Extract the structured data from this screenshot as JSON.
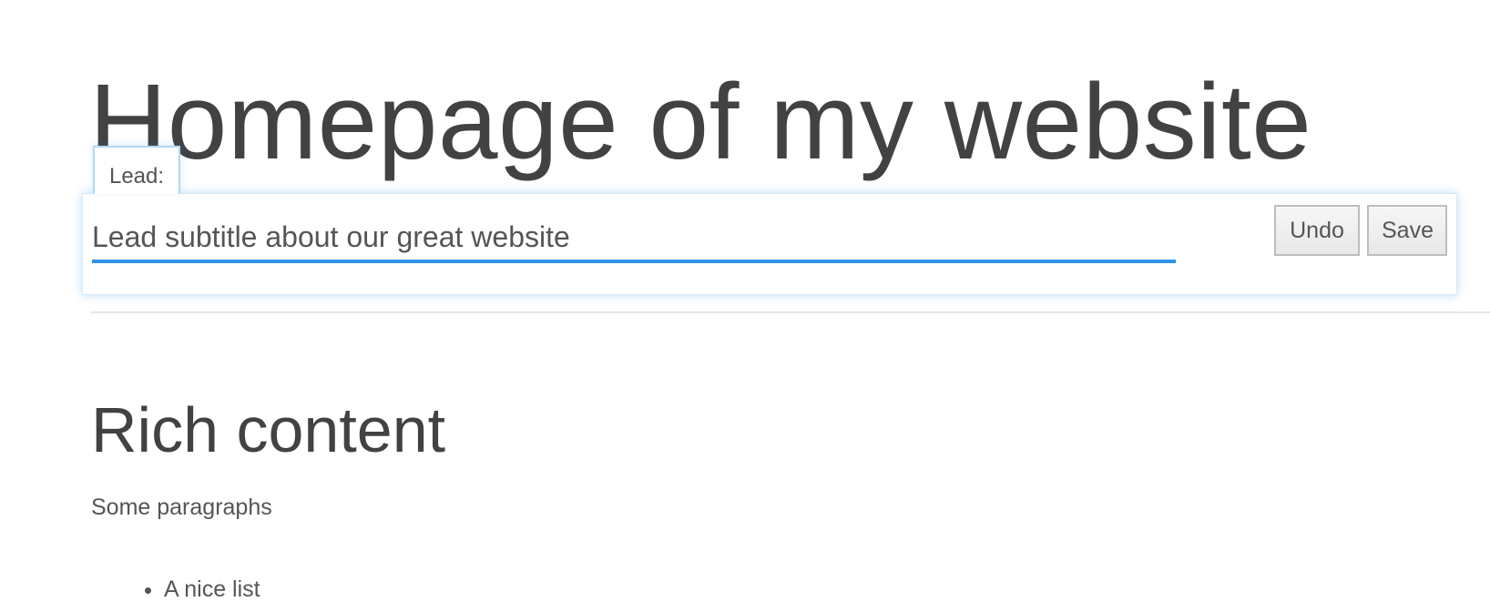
{
  "page": {
    "title": "Homepage of my website"
  },
  "lead_editor": {
    "label": "Lead:",
    "value": "Lead subtitle about our great website",
    "undo_label": "Undo",
    "save_label": "Save",
    "accent_color": "#2f94e4"
  },
  "content": {
    "heading": "Rich content",
    "paragraph": "Some paragraphs",
    "list_items": [
      "A nice list"
    ]
  }
}
